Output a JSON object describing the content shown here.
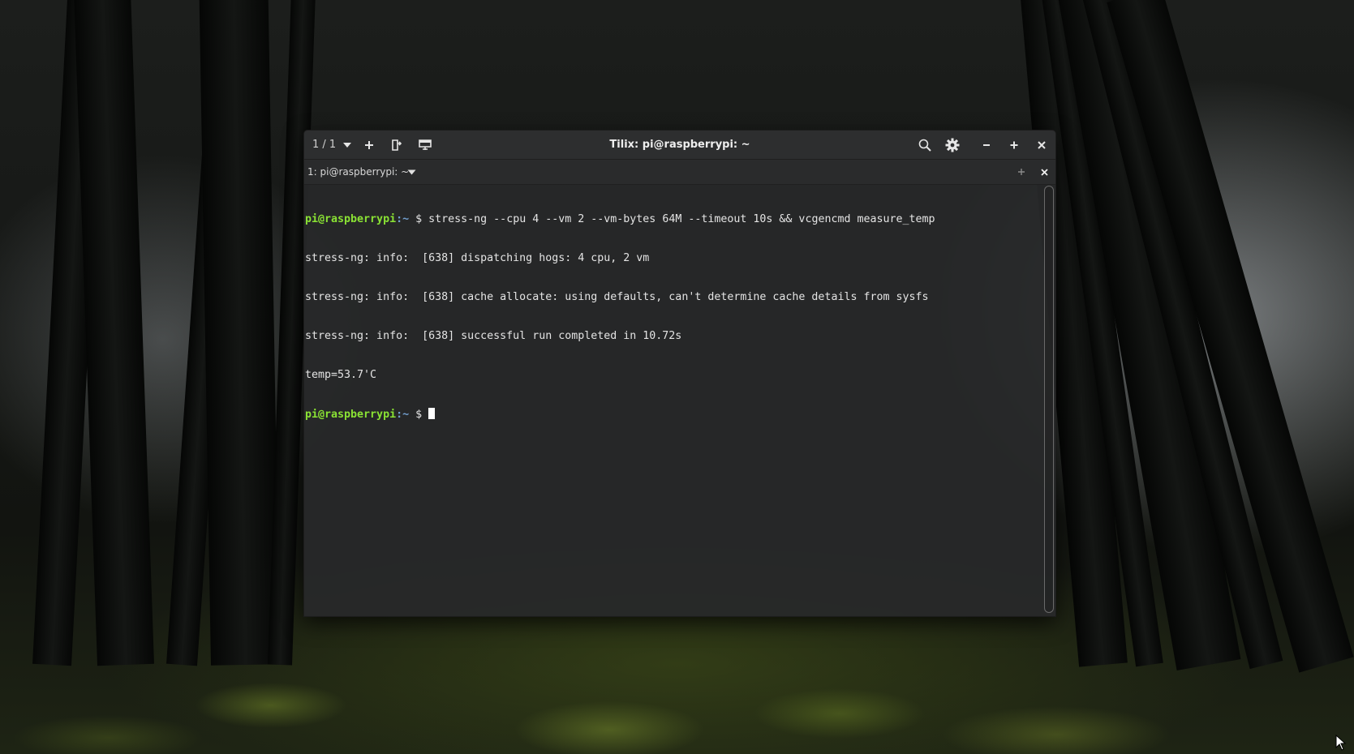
{
  "window": {
    "title": "Tilix: pi@raspberrypi: ~",
    "session_count": "1 / 1"
  },
  "tab": {
    "label": "1: pi@raspberrypi: ~"
  },
  "terminal": {
    "prompt_user": "pi@raspberrypi",
    "prompt_path": ":~",
    "prompt_sign": " $ ",
    "command": "stress-ng --cpu 4 --vm 2 --vm-bytes 64M --timeout 10s && vcgencmd measure_temp",
    "output": [
      "stress-ng: info:  [638] dispatching hogs: 4 cpu, 2 vm",
      "stress-ng: info:  [638] cache allocate: using defaults, can't determine cache details from sysfs",
      "stress-ng: info:  [638] successful run completed in 10.72s",
      "temp=53.7'C"
    ]
  },
  "colors": {
    "prompt_user": "#8ae234",
    "prompt_path": "#729fcf",
    "terminal_bg": "#28292a"
  },
  "icons": {
    "session_dropdown": "chevron-down-icon",
    "add_terminal": "plus-icon",
    "split_terminal": "split-icon",
    "new_window": "window-icon",
    "search": "search-icon",
    "settings": "gear-icon",
    "minimize": "minimize-icon",
    "maximize": "maximize-icon",
    "close": "close-icon"
  }
}
